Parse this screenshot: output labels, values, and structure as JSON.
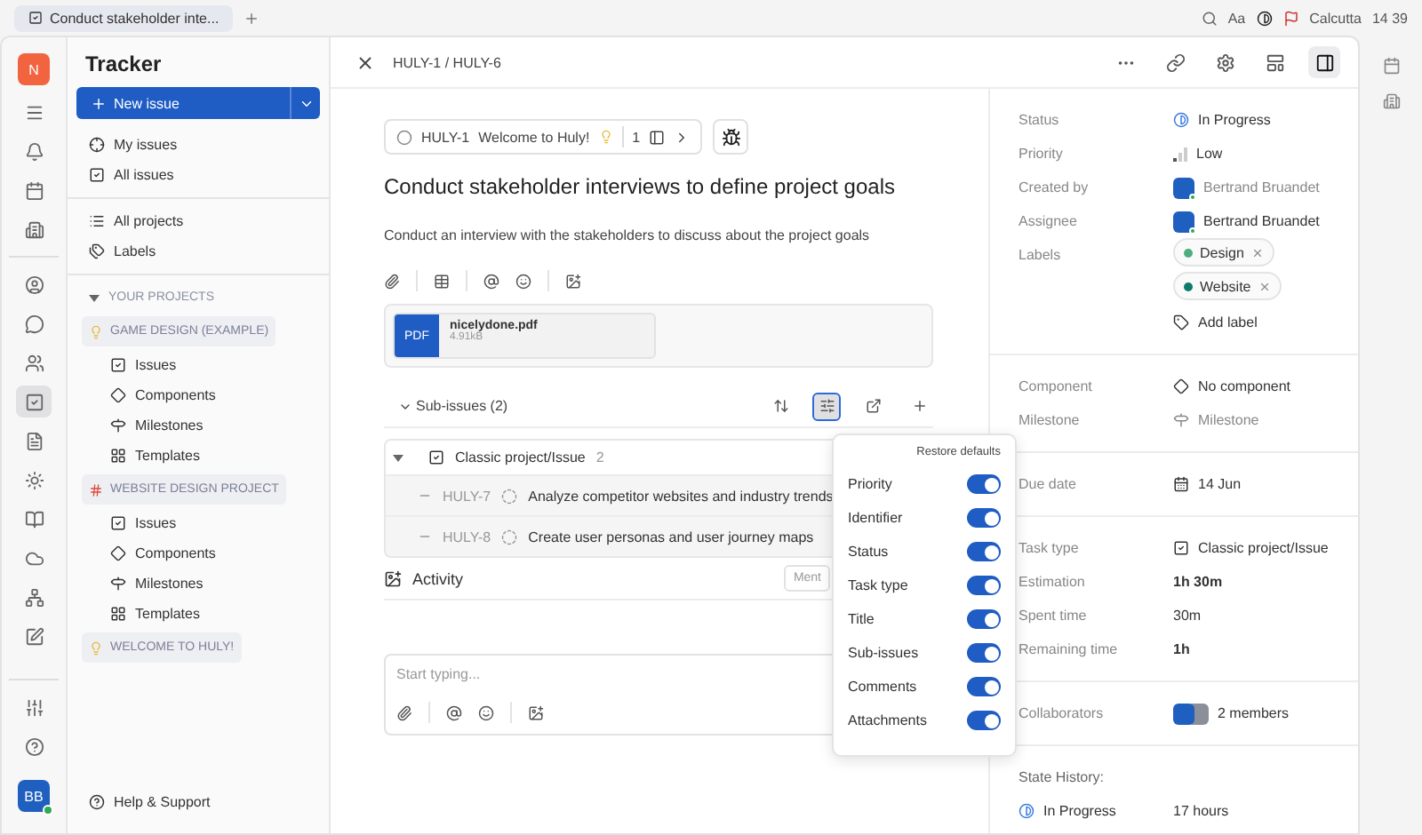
{
  "browser_tab": {
    "title": "Conduct stakeholder inte..."
  },
  "top_bar": {
    "font_button": "Aa",
    "location": "Calcutta",
    "time": "14 39"
  },
  "workspace": {
    "initial": "N"
  },
  "rail": [
    {
      "selected": false
    },
    {
      "selected": false
    },
    {
      "selected": false
    },
    {
      "selected": false
    },
    {
      "selected": false
    },
    {
      "selected": false
    },
    {
      "selected": true
    },
    {
      "selected": false
    },
    {
      "selected": false
    },
    {
      "selected": false
    },
    {
      "selected": false
    },
    {
      "selected": false
    },
    {
      "selected": false
    }
  ],
  "user": {
    "initials": "BB"
  },
  "sidebar": {
    "title": "Tracker",
    "new_issue": "New issue",
    "nav": [
      {
        "label": "My issues"
      },
      {
        "label": "All issues"
      }
    ],
    "nav2": [
      {
        "label": "All projects"
      },
      {
        "label": "Labels"
      }
    ],
    "projects_heading": "YOUR PROJECTS",
    "projects": [
      {
        "name": "GAME DESIGN (EXAMPLE)",
        "kind": "bulb",
        "children": [
          {
            "label": "Issues"
          },
          {
            "label": "Components"
          },
          {
            "label": "Milestones"
          },
          {
            "label": "Templates"
          }
        ]
      },
      {
        "name": "WEBSITE DESIGN PROJECT",
        "kind": "hash",
        "children": [
          {
            "label": "Issues"
          },
          {
            "label": "Components"
          },
          {
            "label": "Milestones"
          },
          {
            "label": "Templates"
          }
        ]
      },
      {
        "name": "WELCOME TO HULY!",
        "kind": "bulb"
      }
    ],
    "help": "Help & Support"
  },
  "breadcrumb": "HULY-1 / HULY-6",
  "parent": {
    "id": "HULY-1",
    "title": "Welcome to Huly!",
    "count": "1"
  },
  "issue": {
    "title": "Conduct stakeholder interviews to define project goals",
    "description": "Conduct an interview with the stakeholders to discuss about the project goals"
  },
  "attachment": {
    "badge": "PDF",
    "name": "nicelydone.pdf",
    "size": "4.91kB"
  },
  "sub_issues": {
    "label": "Sub-issues (2)",
    "group": "Classic project/Issue",
    "count": "2",
    "rows": [
      {
        "id": "HULY-7",
        "title": "Analyze competitor websites and industry trends"
      },
      {
        "id": "HULY-8",
        "title": "Create user personas and user journey maps"
      }
    ]
  },
  "activity": {
    "title": "Activity",
    "mention": "Ment"
  },
  "comment": {
    "placeholder": "Start typing..."
  },
  "popup": {
    "restore": "Restore defaults",
    "options": [
      {
        "label": "Priority",
        "on": true
      },
      {
        "label": "Identifier",
        "on": true
      },
      {
        "label": "Status",
        "on": true
      },
      {
        "label": "Task type",
        "on": true
      },
      {
        "label": "Title",
        "on": true
      },
      {
        "label": "Sub-issues",
        "on": true
      },
      {
        "label": "Comments",
        "on": true
      },
      {
        "label": "Attachments",
        "on": true
      }
    ]
  },
  "details": [
    [
      {
        "label": "Status",
        "kind": "status",
        "value": "In Progress",
        "dimmed": false
      },
      {
        "label": "Priority",
        "kind": "priority",
        "value": "Low",
        "dimmed": false
      },
      {
        "label": "Created by",
        "kind": "person",
        "value": "Bertrand Bruandet",
        "dimmed": true
      },
      {
        "label": "Assignee",
        "kind": "person",
        "value": "Bertrand Bruandet",
        "dimmed": false
      },
      {
        "label": "Labels",
        "kind": "labels",
        "labels": [
          {
            "name": "Design",
            "color": "#4caf7d"
          },
          {
            "name": "Website",
            "color": "#0e7c6b"
          }
        ],
        "value": "Add label",
        "dimmed": false
      }
    ],
    [
      {
        "label": "Component",
        "kind": "component",
        "value": "No component",
        "dimmed": false
      },
      {
        "label": "Milestone",
        "kind": "milestone",
        "value": "Milestone",
        "dimmed": true
      }
    ],
    [
      {
        "label": "Due date",
        "kind": "date",
        "value": "14 Jun",
        "dimmed": false
      }
    ],
    [
      {
        "label": "Task type",
        "kind": "tasktype",
        "value": "Classic project/Issue",
        "dimmed": false
      },
      {
        "label": "Estimation",
        "kind": "bold",
        "value": "1h 30m",
        "dimmed": false
      },
      {
        "label": "Spent time",
        "kind": "text",
        "value": "30m",
        "dimmed": false
      },
      {
        "label": "Remaining time",
        "kind": "bold",
        "value": "1h",
        "dimmed": false
      }
    ],
    [
      {
        "label": "Collaborators",
        "kind": "collaborators",
        "value": "2 members",
        "dimmed": false
      }
    ]
  ],
  "state_history": {
    "title": "State History:",
    "entries": [
      {
        "state": "In Progress",
        "duration": "17 hours"
      }
    ]
  }
}
